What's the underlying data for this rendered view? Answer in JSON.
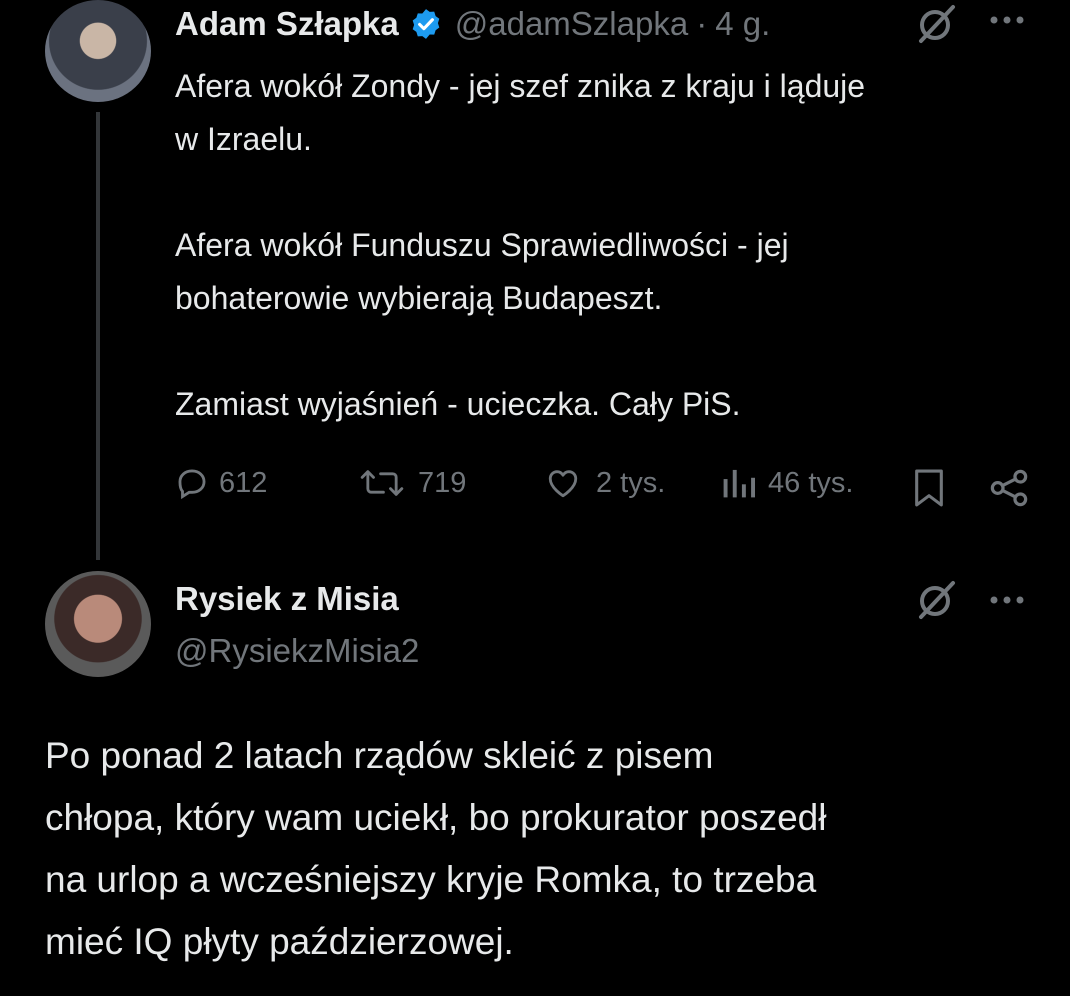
{
  "tweet1": {
    "name": "Adam Szłapka",
    "handle": "@adamSzlapka",
    "separator": "·",
    "time": "4 g.",
    "paragraphs": [
      "Afera wokół Zondy - jej szef znika z kraju i ląduje",
      "w Izraelu.",
      "",
      "Afera wokół Funduszu Sprawiedliwości - jej",
      "bohaterowie wybierają Budapeszt.",
      "",
      "Zamiast wyjaśnień - ucieczka. Cały PiS."
    ],
    "metrics": {
      "replies": "612",
      "reposts": "719",
      "likes": "2 tys.",
      "views": "46 tys."
    }
  },
  "tweet2": {
    "name": "Rysiek z Misia",
    "handle": "@RysiekzMisia2",
    "lines": [
      "Po ponad 2 latach rządów skleić z pisem",
      "chłopa, który wam uciekł, bo prokurator poszedł",
      "na urlop a wcześniejszy kryje Romka, to trzeba",
      "mieć IQ płyty paździerzowej."
    ]
  },
  "icons": {
    "verified": "verified-badge-icon",
    "grok": "grok-icon",
    "more": "more-icon",
    "reply": "reply-icon",
    "repost": "repost-icon",
    "like": "like-icon",
    "views": "views-icon",
    "bookmark": "bookmark-icon",
    "share": "share-icon"
  },
  "colors": {
    "background": "#000000",
    "text": "#e7e9ea",
    "muted": "#71767b",
    "verified": "#1d9bf0"
  }
}
